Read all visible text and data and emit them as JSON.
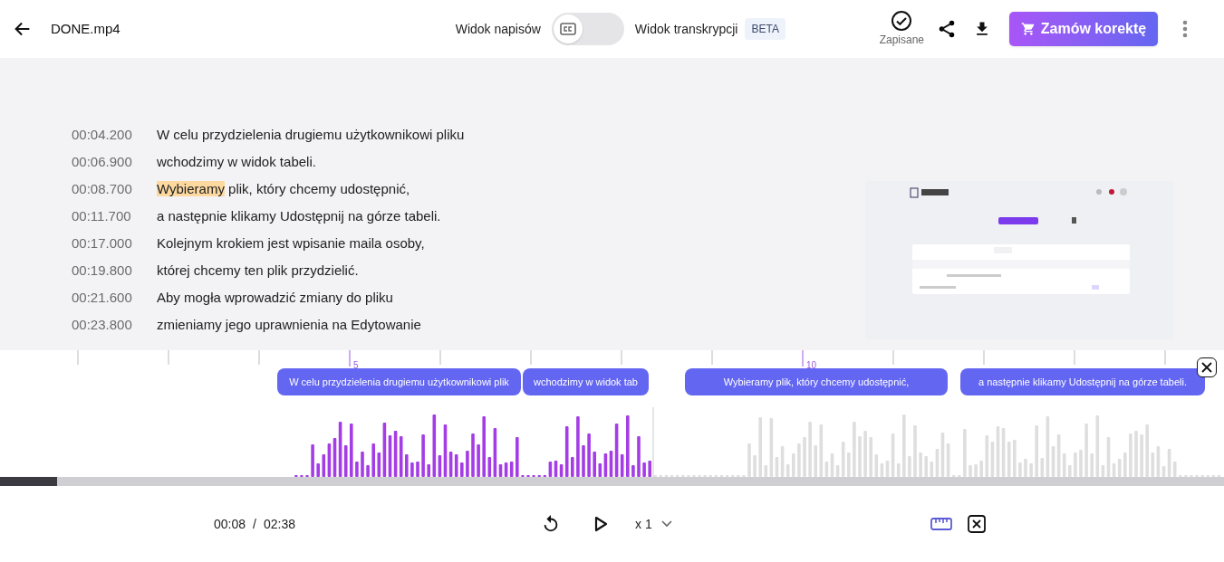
{
  "header": {
    "title": "DONE.mp4",
    "view_left": "Widok napisów",
    "toggle": {
      "on": false
    },
    "view_right": "Widok transkrypcji",
    "badge": "BETA",
    "saved_label": "Zapisane",
    "order_button": "Zamów korektę"
  },
  "transcript": [
    {
      "time": "00:04.200",
      "text": "W celu przydzielenia drugiemu użytkownikowi pliku"
    },
    {
      "time": "00:06.900",
      "text": "wchodzimy w widok tabeli."
    },
    {
      "time": "00:08.700",
      "segments": [
        {
          "text": "Wybieramy",
          "highlighted": true
        },
        {
          "text": " plik, który chcemy udostępnić,",
          "highlighted": false
        }
      ]
    },
    {
      "time": "00:11.700",
      "text": "a następnie klikamy Udostępnij na górze tabeli."
    },
    {
      "time": "00:17.000",
      "text": "Kolejnym krokiem jest wpisanie maila osoby,"
    },
    {
      "time": "00:19.800",
      "text": "której chcemy ten plik przydzielić."
    },
    {
      "time": "00:21.600",
      "text": "Aby mogła wprowadzić zmiany do pliku"
    },
    {
      "time": "00:23.800",
      "text": "zmieniamy jego uprawnienia na Edytowanie"
    }
  ],
  "timeline": {
    "tick_labels": [
      "5",
      "10"
    ],
    "subtitles": [
      {
        "text": "W celu przydzielenia drugiemu użytkownikowi plik"
      },
      {
        "text": "wchodzimy w widok tab"
      },
      {
        "text": "Wybieramy plik, który chcemy udostępnić,"
      },
      {
        "text": "a następnie klikamy Udostępnij na górze tabeli."
      }
    ]
  },
  "progress": {
    "level": 0.047
  },
  "player": {
    "current": "00:08",
    "separator": "/",
    "total": "02:38",
    "speed": "x 1"
  }
}
